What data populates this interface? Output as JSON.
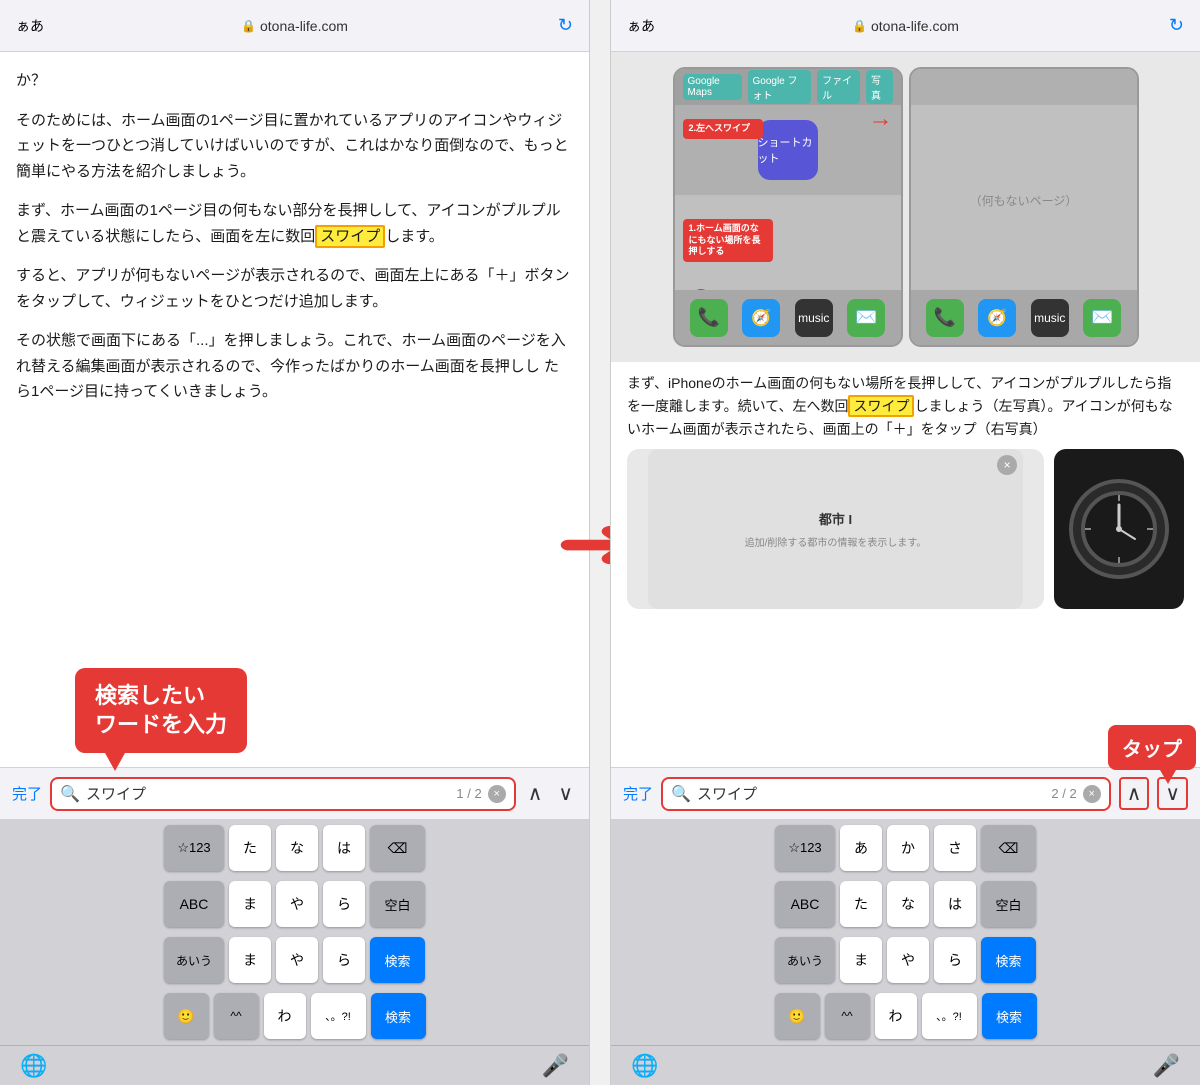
{
  "left_panel": {
    "browser_aa": "ぁあ",
    "browser_url": "otona-life.com",
    "content": {
      "para1": "か？",
      "para2": "そのためには、ホーム画面の1ページ目に置かれているアプリのアイコンやウィジェットを一つひとつ消していけばいいのですが、これはかなり面倒なので、もっと簡単にやる方法を紹介しましょう。",
      "para3_pre": "まず、ホーム画面の1ページ目の何もない部分を長押しして、アイコンがプルプルと震えている状態にしたら、画面を左に数回",
      "highlight1": "スワイプ",
      "para3_post": "します。",
      "para4": "すると、アプリが何もないページが表示されるので、画面左上にある「＋」ボタンをタップして、ウィジェットをひとつだけ追加します。",
      "para5": "その状態で画面下にある「...」を押しましょう。これで、ホーム画面のページを入れ替える編集画面が表示されるので、今作ったばかりのホーム画面を長押しし\tたら1ページ目に持ってくいきましょう。"
    },
    "search_bar": {
      "done": "完了",
      "icon": "🔍",
      "query": "スワイプ",
      "count": "1 / 2",
      "clear_label": "×"
    },
    "tooltip": "検索したい\nワードを入力",
    "keyboard": {
      "row1": [
        "☆123",
        "た",
        "な",
        "は",
        "⌫"
      ],
      "row2": [
        "ABC",
        "ま",
        "や",
        "ら",
        "空白"
      ],
      "row3": [
        "あいう",
        "ま",
        "や",
        "ら",
        "検索"
      ],
      "row4": [
        "🙂",
        "^^",
        "わ",
        "、。?!",
        "検索"
      ]
    }
  },
  "arrow": "➜",
  "right_panel": {
    "browser_aa": "ぁあ",
    "browser_url": "otona-life.com",
    "content_text": "まず、iPhoneのホーム画面の何もない場所を長押しして、アイコンがプルプルしたら指を一度離します。続いて、左へ数回",
    "highlight": "スワイプ",
    "content_text2": "しましょう（左写真）。アイコンが何もないホーム画面が表示されたら、画面上の「＋」をタップ（右写真）",
    "search_bar": {
      "done": "完了",
      "icon": "🔍",
      "query": "スワイプ",
      "count": "2 / 2",
      "clear_label": "×"
    },
    "tap_label": "タップ",
    "nav_arrows_label": "^ ∨",
    "widget_name": "都市 I",
    "widget_sub": "追加/削除する都市の情報を表示します。",
    "clock_label": "時計"
  }
}
